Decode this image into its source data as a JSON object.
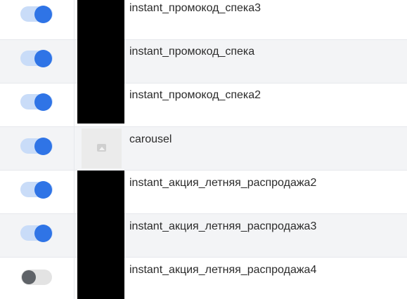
{
  "rows": [
    {
      "name": "instant_промокод_спека3",
      "enabled": true,
      "thumbnail": "blacked-out"
    },
    {
      "name": "instant_промокод_спека",
      "enabled": true,
      "thumbnail": "blacked-out"
    },
    {
      "name": "instant_промокод_спека2",
      "enabled": true,
      "thumbnail": "blacked-out"
    },
    {
      "name": "carousel",
      "enabled": true,
      "thumbnail": "image-placeholder-icon"
    },
    {
      "name": "instant_акция_летняя_распродажа2",
      "enabled": true,
      "thumbnail": "blacked-out"
    },
    {
      "name": "instant_акция_летняя_распродажа3",
      "enabled": true,
      "thumbnail": "blacked-out"
    },
    {
      "name": "instant_акция_летняя_распродажа4",
      "enabled": false,
      "thumbnail": "blacked-out"
    }
  ],
  "colors": {
    "toggle_on_knob": "#2f74e6",
    "toggle_on_track": "#c9dcf8",
    "toggle_off_knob": "#5f6368",
    "toggle_off_track": "#e3e3e3",
    "row_alt_bg": "#f3f4f6"
  }
}
